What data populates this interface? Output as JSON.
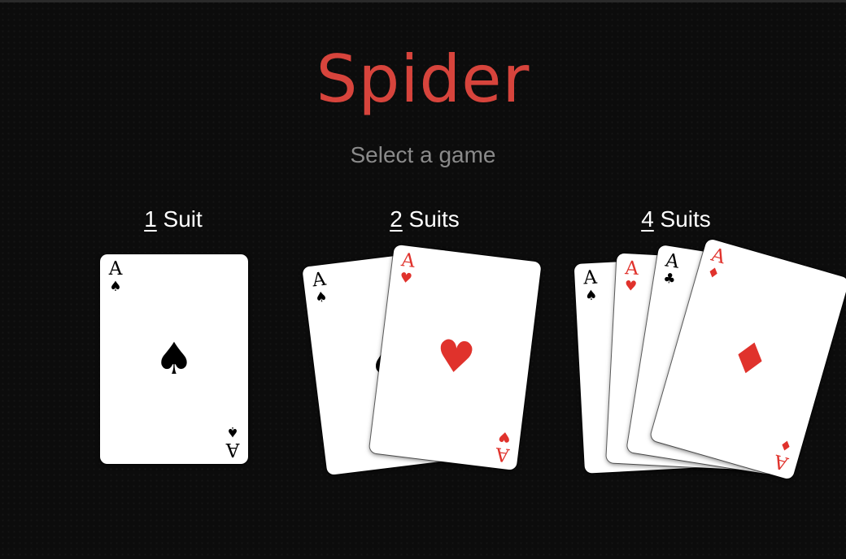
{
  "title": "Spider",
  "subtitle": "Select a game",
  "colors": {
    "title": "#d7443c",
    "red_suit": "#e0322c",
    "black_suit": "#000000",
    "background": "#0c0c0c"
  },
  "options": [
    {
      "key": "1",
      "label": " Suit",
      "cards": [
        {
          "rank": "A",
          "suit": "♠",
          "color": "black"
        }
      ]
    },
    {
      "key": "2",
      "label": " Suits",
      "cards": [
        {
          "rank": "A",
          "suit": "♠",
          "color": "black"
        },
        {
          "rank": "A",
          "suit": "♥",
          "color": "red"
        }
      ]
    },
    {
      "key": "4",
      "label": " Suits",
      "cards": [
        {
          "rank": "A",
          "suit": "♠",
          "color": "black"
        },
        {
          "rank": "A",
          "suit": "♥",
          "color": "red"
        },
        {
          "rank": "A",
          "suit": "♣",
          "color": "black"
        },
        {
          "rank": "A",
          "suit": "♦",
          "color": "red"
        }
      ]
    }
  ]
}
